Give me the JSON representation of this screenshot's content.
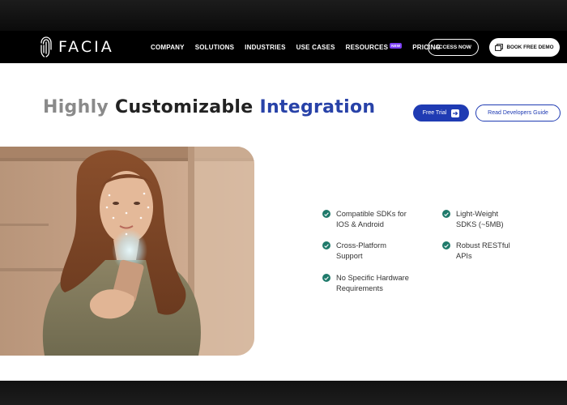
{
  "brand": {
    "name": "FACIA",
    "logo_icon": "fingerprint-icon"
  },
  "nav": {
    "links": [
      "COMPANY",
      "SOLUTIONS",
      "INDUSTRIES",
      "USE CASES",
      "RESOURCES",
      "PRICING"
    ],
    "new_badge": "NEW",
    "access_now": "ACCESS NOW",
    "book_demo": "BOOK FREE DEMO"
  },
  "hero": {
    "headline_part1": "Highly",
    "headline_part2": "Customizable",
    "headline_part3": "Integration",
    "free_trial": "Free Trial",
    "developers_guide": "Read Developers Guide"
  },
  "features": {
    "left": [
      {
        "line1": "Compatible SDKs for",
        "line2": "IOS & Android"
      },
      {
        "line1": "Cross-Platform",
        "line2": "Support"
      },
      {
        "line1": "No Specific Hardware",
        "line2": "Requirements"
      }
    ],
    "right": [
      {
        "line1": "Light-Weight",
        "line2": "SDKS (~5MB)"
      },
      {
        "line1": "Robust RESTful",
        "line2": "APIs"
      }
    ]
  },
  "colors": {
    "accent": "#1f3bb3",
    "check": "#1f7a6b",
    "navbar": "#000000"
  }
}
